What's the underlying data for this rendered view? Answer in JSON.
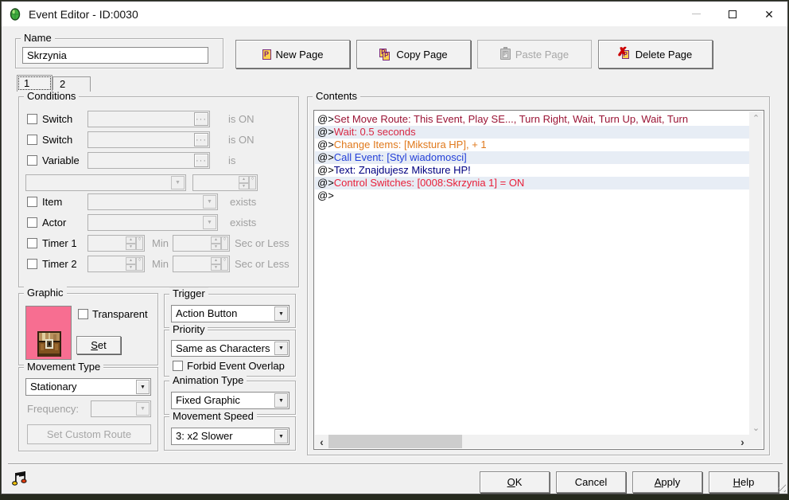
{
  "window": {
    "title": "Event Editor - ID:0030"
  },
  "name_group": {
    "label": "Name",
    "value": "Skrzynia"
  },
  "page_buttons": {
    "new": "New Page",
    "copy": "Copy Page",
    "paste": "Paste Page",
    "delete": "Delete Page"
  },
  "tabs": {
    "tab1": "1",
    "tab2": "2",
    "selected": "1"
  },
  "conditions": {
    "label": "Conditions",
    "switch1": {
      "label": "Switch",
      "suffix": "is ON"
    },
    "switch2": {
      "label": "Switch",
      "suffix": "is ON"
    },
    "variable": {
      "label": "Variable",
      "suffix": "is"
    },
    "item": {
      "label": "Item",
      "suffix": "exists"
    },
    "actor": {
      "label": "Actor",
      "suffix": "exists"
    },
    "timer1": {
      "label": "Timer 1",
      "mid": "Min",
      "suffix": "Sec or Less"
    },
    "timer2": {
      "label": "Timer 2",
      "mid": "Min",
      "suffix": "Sec or Less"
    }
  },
  "graphic": {
    "label": "Graphic",
    "transparent_label": "Transparent",
    "set_button": {
      "ul": "S",
      "rest": "et"
    },
    "bg_color": "#f76e91"
  },
  "movement": {
    "label": "Movement Type",
    "value": "Stationary",
    "frequency_label": "Frequency:",
    "route_button": "Set Custom Route"
  },
  "trigger": {
    "label": "Trigger",
    "value": "Action Button"
  },
  "priority": {
    "label": "Priority",
    "value": "Same as Characters",
    "overlap_label": "Forbid Event Overlap"
  },
  "animation": {
    "label": "Animation Type",
    "value": "Fixed Graphic"
  },
  "speed": {
    "label": "Movement Speed",
    "value": "3: x2 Slower"
  },
  "contents": {
    "label": "Contents",
    "shaded_row_color": "#e7edf5",
    "lines": [
      {
        "prefix": "@>",
        "text": "Set Move Route: This Event, Play SE..., Turn Right, Wait, Turn Up, Wait, Turn",
        "color": "#9a1435",
        "shaded": false
      },
      {
        "prefix": "@>",
        "text": "Wait: 0.5 seconds",
        "color": "#d82844",
        "shaded": true
      },
      {
        "prefix": "@>",
        "text": "Change Items: [Mikstura HP], + 1",
        "color": "#e0791c",
        "shaded": false
      },
      {
        "prefix": "@>",
        "text": "Call Event: [Styl wiadomosci]",
        "color": "#2440d8",
        "shaded": true
      },
      {
        "prefix": "@>",
        "text": "Text: Znajdujesz Miksture HP!",
        "color": "#000080",
        "shaded": false
      },
      {
        "prefix": "@>",
        "text": "Control Switches: [0008:Skrzynia 1] = ON",
        "color": "#e81e38",
        "shaded": true
      },
      {
        "prefix": "@>",
        "text": "",
        "color": "#000000",
        "shaded": false
      }
    ]
  },
  "footer": {
    "ok": {
      "ul": "O",
      "rest": "K"
    },
    "cancel": {
      "ul": "",
      "rest": "Cancel"
    },
    "apply": {
      "ul": "A",
      "rest": "pply"
    },
    "help": {
      "ul": "H",
      "rest": "elp"
    }
  },
  "icons": {
    "page_letter": "P",
    "ellipsis": "···",
    "combo_arrow": "▼",
    "spin_up": "▲",
    "spin_down": "▼",
    "spin_side": "◊",
    "scroll_up": "⌃",
    "scroll_down": "⌄",
    "scroll_left": "‹",
    "scroll_right": "›",
    "close": "✕"
  }
}
